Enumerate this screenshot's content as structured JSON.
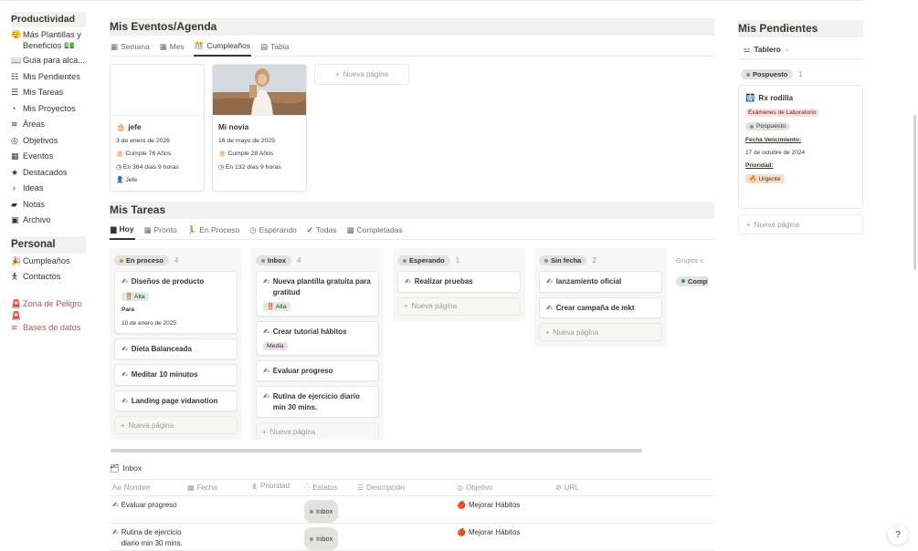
{
  "sidebar": {
    "section1": "Productividad",
    "items1": [
      {
        "icon": "😮‍💨",
        "icon_name": "face-icon",
        "label": "Más Plantillas y Beneficios 💵"
      },
      {
        "icon": "📖",
        "icon_name": "book-icon",
        "label": "Guía para alca..."
      },
      {
        "icon": "☷",
        "icon_name": "checklist-icon",
        "label": "Mis Pendientes"
      },
      {
        "icon": "☰",
        "icon_name": "list-icon",
        "label": "Mis Tareas"
      },
      {
        "icon": "◔",
        "icon_name": "target-icon",
        "label": "Mis Proyectos"
      },
      {
        "icon": "≋",
        "icon_name": "stack-icon",
        "label": "Áreas"
      },
      {
        "icon": "◎",
        "icon_name": "bullseye-icon",
        "label": "Objetivos"
      },
      {
        "icon": "▦",
        "icon_name": "calendar-icon",
        "label": "Eventos"
      },
      {
        "icon": "★",
        "icon_name": "star-icon",
        "label": "Destacados"
      },
      {
        "icon": "♁",
        "icon_name": "lightbulb-icon",
        "label": "Ideas"
      },
      {
        "icon": "▰",
        "icon_name": "notes-icon",
        "label": "Notas"
      },
      {
        "icon": "▣",
        "icon_name": "archive-icon",
        "label": "Archivo"
      }
    ],
    "section2": "Personal",
    "items2": [
      {
        "icon": "🎉",
        "icon_name": "party-icon",
        "label": "Cumpleaños"
      },
      {
        "icon": "🯅",
        "icon_name": "person-icon",
        "label": "Contactos"
      }
    ],
    "danger": {
      "icon": "🚨",
      "label": "Zona de Peligro"
    },
    "danger2_icon": "🚨",
    "databases": {
      "icon": "≋",
      "label": "Bases de datos"
    }
  },
  "events": {
    "title": "Mis Eventos/Agenda",
    "tabs": [
      {
        "icon": "▦",
        "label": "Semana"
      },
      {
        "icon": "▦",
        "label": "Mes"
      },
      {
        "icon": "🎊",
        "label": "Cumpleaños"
      },
      {
        "icon": "▤",
        "label": "Tabla"
      }
    ],
    "cards": [
      {
        "icon": "🎂",
        "name": "jefe",
        "date": "3 de enero de 2026",
        "age": "Cumple 76 Años",
        "remaining": "En 364 días 9 horas",
        "relation": "Jefe"
      },
      {
        "icon": "",
        "name": "Mi novia",
        "date": "16 de mayo de 2025",
        "age": "Cumple 28 Años",
        "remaining": "En 132 días 9 horas",
        "relation": ""
      }
    ],
    "new_page": "Nueva página"
  },
  "tasks": {
    "title": "Mis Tareas",
    "tabs": [
      {
        "icon": "▆",
        "label": "Hoy"
      },
      {
        "icon": "▦",
        "label": "Pronto"
      },
      {
        "icon": "🏃",
        "label": "En Proceso"
      },
      {
        "icon": "◷",
        "label": "Esperando"
      },
      {
        "icon": "✔",
        "label": "Todas"
      },
      {
        "icon": "▩",
        "label": "Completadas"
      }
    ],
    "columns": [
      {
        "label": "En proceso",
        "count": "4"
      },
      {
        "label": "Inbox",
        "count": "4"
      },
      {
        "label": "Esperando",
        "count": "1"
      },
      {
        "label": "Sin fecha",
        "count": "2"
      }
    ],
    "col1": {
      "card1_title": "Diseños de producto",
      "card1_tag": "‼️ Alta",
      "card1_prop_label": "Para",
      "card1_prop_value": "10 de enero de 2025",
      "card2": "Dieta Balanceada",
      "card3": "Meditar 10 minutos",
      "card4": "Landing page vidanotion"
    },
    "col2": {
      "card1_title": "Nueva plantilla gratuita para gratitud",
      "card1_tag": "‼️ Alta",
      "card2_title": "Crear tutorial hábitos",
      "card2_tag": "Media",
      "card3": "Evaluar progreso",
      "card4": "Rutina de ejercicio diario min 30 mins."
    },
    "col3": {
      "card1": "Realizar pruebas"
    },
    "col4": {
      "card1": "lanzamiento oficial",
      "card2": "Crear campaña de mkt"
    },
    "hidden_groups": "Grupos c",
    "hidden_item": "Compl",
    "new_page": "Nueva página",
    "task_icon": "✍"
  },
  "inbox": {
    "title": "Inbox",
    "headers": [
      {
        "icon": "Aa",
        "label": "Nombre"
      },
      {
        "icon": "▦",
        "label": "Fecha"
      },
      {
        "icon": "🯅",
        "label": "Prioridad"
      },
      {
        "icon": "⁛",
        "label": "Estatus"
      },
      {
        "icon": "☰",
        "label": "Descripción"
      },
      {
        "icon": "◎",
        "label": "Objetivo"
      },
      {
        "icon": "⊘",
        "label": "URL"
      }
    ],
    "rows": [
      {
        "name": "Evaluar progreso",
        "status": "Inbox",
        "objective": "Mejorar Hábitos"
      },
      {
        "name": "Rutina de ejercicio diario min 30 mins.",
        "status": "Inbox",
        "objective": "Mejorar Hábitos"
      }
    ],
    "objective_icon": "🍎"
  },
  "pending": {
    "title": "Mis Pendientes",
    "view": "Tablero",
    "group": "Pospuesto",
    "group_count": "1",
    "card": {
      "icon": "🩻",
      "title": "Rx rodilla",
      "tag": "Exámenes de Laboratorio",
      "status": "Pospuesto",
      "due_label": "Fecha Vencimiento:",
      "due_value": "17 de octubre de 2024",
      "priority_label": "Prioridad:",
      "priority_value": "🔥 Urgente"
    },
    "new_page": "Nueva página"
  },
  "help": "?"
}
